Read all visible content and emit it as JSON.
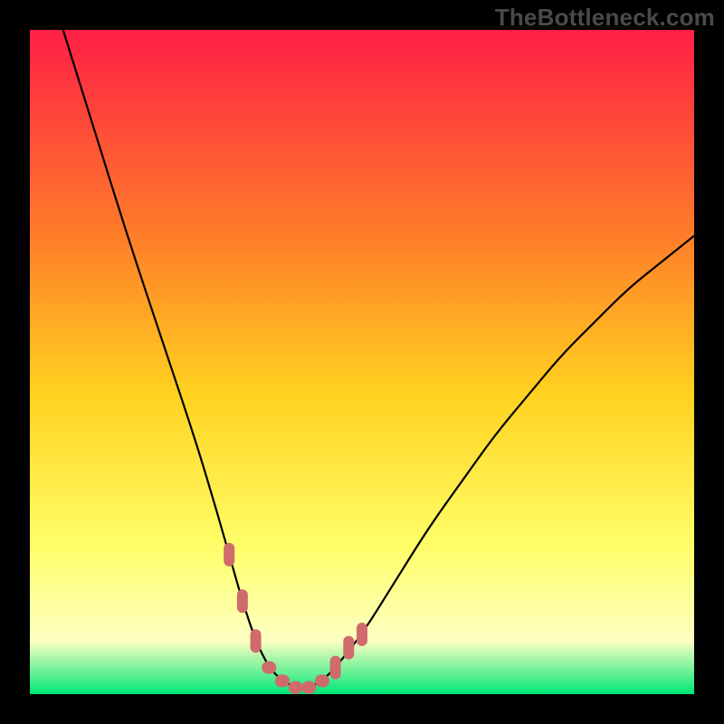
{
  "watermark": "TheBottleneck.com",
  "colors": {
    "page_bg": "#000000",
    "gradient_top": "#ff1f45",
    "gradient_mid1": "#ff7a2a",
    "gradient_mid2": "#ffd21f",
    "gradient_mid3": "#ffff6a",
    "gradient_mid4": "#fdffc2",
    "gradient_bottom": "#00e676",
    "curve_stroke": "#000000",
    "marker_fill": "#cf6b6b"
  },
  "chart_data": {
    "type": "line",
    "title": "",
    "xlabel": "",
    "ylabel": "",
    "xlim": [
      0,
      100
    ],
    "ylim": [
      0,
      100
    ],
    "series": [
      {
        "name": "bottleneck-curve",
        "x": [
          5,
          10,
          15,
          20,
          25,
          28,
          30,
          32,
          34,
          36,
          38,
          40,
          42,
          44,
          46,
          50,
          55,
          60,
          65,
          70,
          75,
          80,
          85,
          90,
          95,
          100
        ],
        "y": [
          100,
          84,
          68,
          53,
          38,
          28,
          21,
          14,
          8,
          4,
          2,
          1,
          1,
          2,
          4,
          9,
          17,
          25,
          32,
          39,
          45,
          51,
          56,
          61,
          65,
          69
        ]
      }
    ],
    "markers": {
      "name": "highlighted-points",
      "x": [
        30,
        32,
        34,
        36,
        38,
        40,
        42,
        44,
        46,
        48,
        50
      ],
      "y": [
        21,
        14,
        8,
        4,
        2,
        1,
        1,
        2,
        4,
        7,
        9
      ]
    }
  }
}
